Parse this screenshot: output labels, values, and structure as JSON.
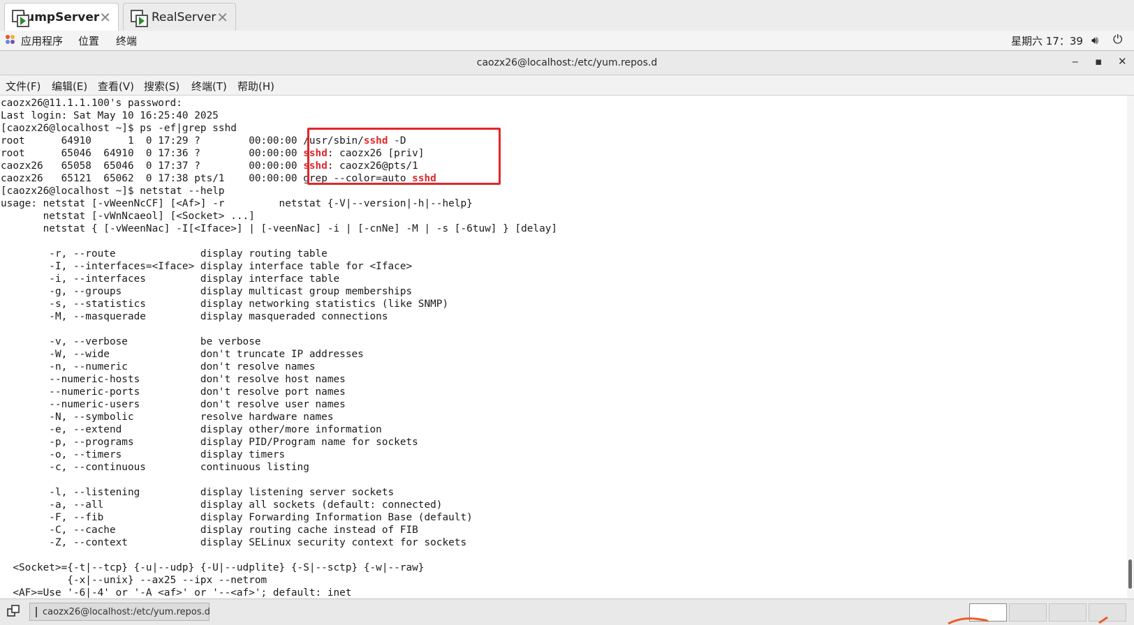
{
  "tabs": [
    {
      "label": "JumpServer",
      "active": true,
      "close": "✕"
    },
    {
      "label": "RealServer",
      "active": false,
      "close": "✕"
    }
  ],
  "panel": {
    "apps": "应用程序",
    "places": "位置",
    "terminal": "终端",
    "clock": "星期六 17：39",
    "volume_icon": "volume-icon",
    "power_icon": "power-icon"
  },
  "window": {
    "title": "caozx26@localhost:/etc/yum.repos.d",
    "minimize": "‒",
    "maximize": "▪",
    "close": "✕"
  },
  "menu": [
    "文件(F)",
    "编辑(E)",
    "查看(V)",
    "搜索(S)",
    "终端(T)",
    "帮助(H)"
  ],
  "terminal": {
    "lines": [
      "caozx26@11.1.1.100's password:",
      "Last login: Sat May 10 16:25:40 2025",
      "[caozx26@localhost ~]$ ps -ef|grep sshd",
      "root      64910      1  0 17:29 ?        00:00:00 ",
      "root      65046  64910  0 17:36 ?        00:00:00 ",
      "caozx26   65058  65046  0 17:37 ?        00:00:00 ",
      "caozx26   65121  65062  0 17:38 pts/1    00:00:00 ",
      "[caozx26@localhost ~]$ netstat --help",
      "usage: netstat [-vWeenNcCF] [<Af>] -r         netstat {-V|--version|-h|--help}",
      "       netstat [-vWnNcaeol] [<Socket> ...]",
      "       netstat { [-vWeenNac] -I[<Iface>] | [-veenNac] -i | [-cnNe] -M | -s [-6tuw] } [delay]",
      "",
      "        -r, --route              display routing table",
      "        -I, --interfaces=<Iface> display interface table for <Iface>",
      "        -i, --interfaces         display interface table",
      "        -g, --groups             display multicast group memberships",
      "        -s, --statistics         display networking statistics (like SNMP)",
      "        -M, --masquerade         display masqueraded connections",
      "",
      "        -v, --verbose            be verbose",
      "        -W, --wide               don't truncate IP addresses",
      "        -n, --numeric            don't resolve names",
      "        --numeric-hosts          don't resolve host names",
      "        --numeric-ports          don't resolve port names",
      "        --numeric-users          don't resolve user names",
      "        -N, --symbolic           resolve hardware names",
      "        -e, --extend             display other/more information",
      "        -p, --programs           display PID/Program name for sockets",
      "        -o, --timers             display timers",
      "        -c, --continuous         continuous listing",
      "",
      "        -l, --listening          display listening server sockets",
      "        -a, --all                display all sockets (default: connected)",
      "        -F, --fib                display Forwarding Information Base (default)",
      "        -C, --cache              display routing cache instead of FIB",
      "        -Z, --context            display SELinux security context for sockets",
      "",
      "  <Socket>={-t|--tcp} {-u|--udp} {-U|--udplite} {-S|--sctp} {-w|--raw}",
      "           {-x|--unix} --ax25 --ipx --netrom",
      "  <AF>=Use '-6|-4' or '-A <af>' or '--<af>'; default: inet"
    ],
    "cmd_parts": [
      {
        "pre": "/usr/sbin/",
        "hl": "sshd",
        "post": " -D"
      },
      {
        "pre": "",
        "hl": "sshd",
        "post": ": caozx26 [priv]"
      },
      {
        "pre": "",
        "hl": "sshd",
        "post": ": caozx26@pts/1"
      },
      {
        "pre": "grep --color=auto ",
        "hl": "sshd",
        "post": ""
      }
    ],
    "highlight_color": "#e0282e",
    "box_color": "#e2262b"
  },
  "taskbar": {
    "show_desktop_icon": "show-desktop-icon",
    "task_label": "caozx26@localhost:/etc/yum.repos.d",
    "workspaces": 4,
    "active_workspace": 1
  }
}
